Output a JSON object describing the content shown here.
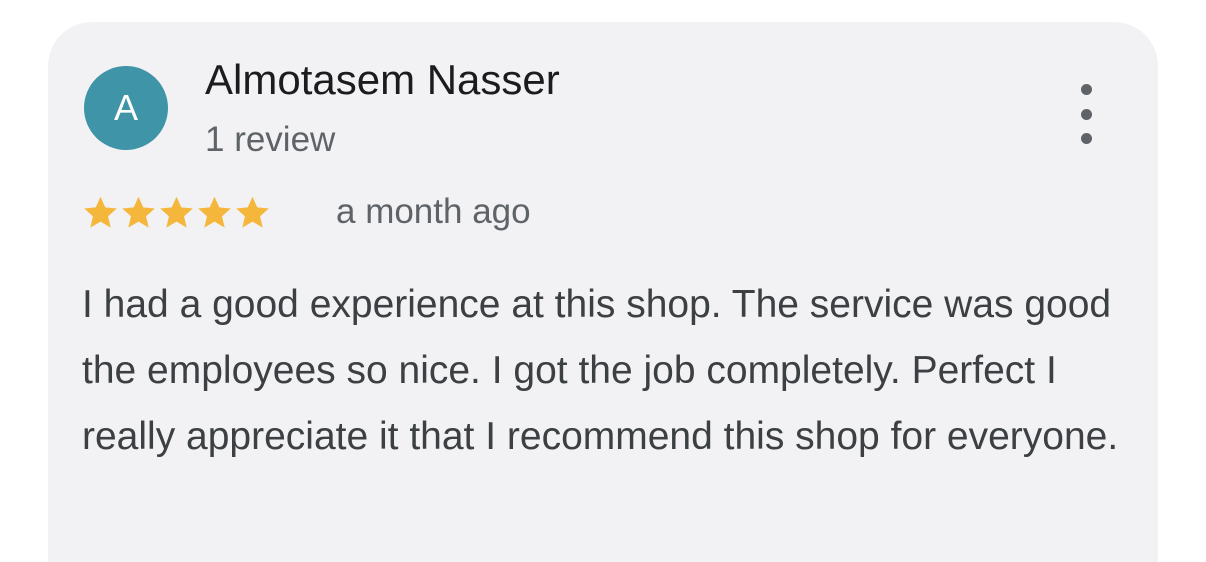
{
  "review": {
    "author": {
      "initial": "A",
      "name": "Almotasem Nasser",
      "review_count": "1 review",
      "avatar_color": "#3f94a8"
    },
    "rating": {
      "stars": 5,
      "max": 5,
      "star_color": "#f5b73b"
    },
    "time": "a month ago",
    "text": "I had a good experience at this shop. The service was good the employees so nice. I got the job completely. Perfect I really appreciate it that I recommend this shop for everyone.",
    "menu_icon": "more-vert-icon"
  }
}
